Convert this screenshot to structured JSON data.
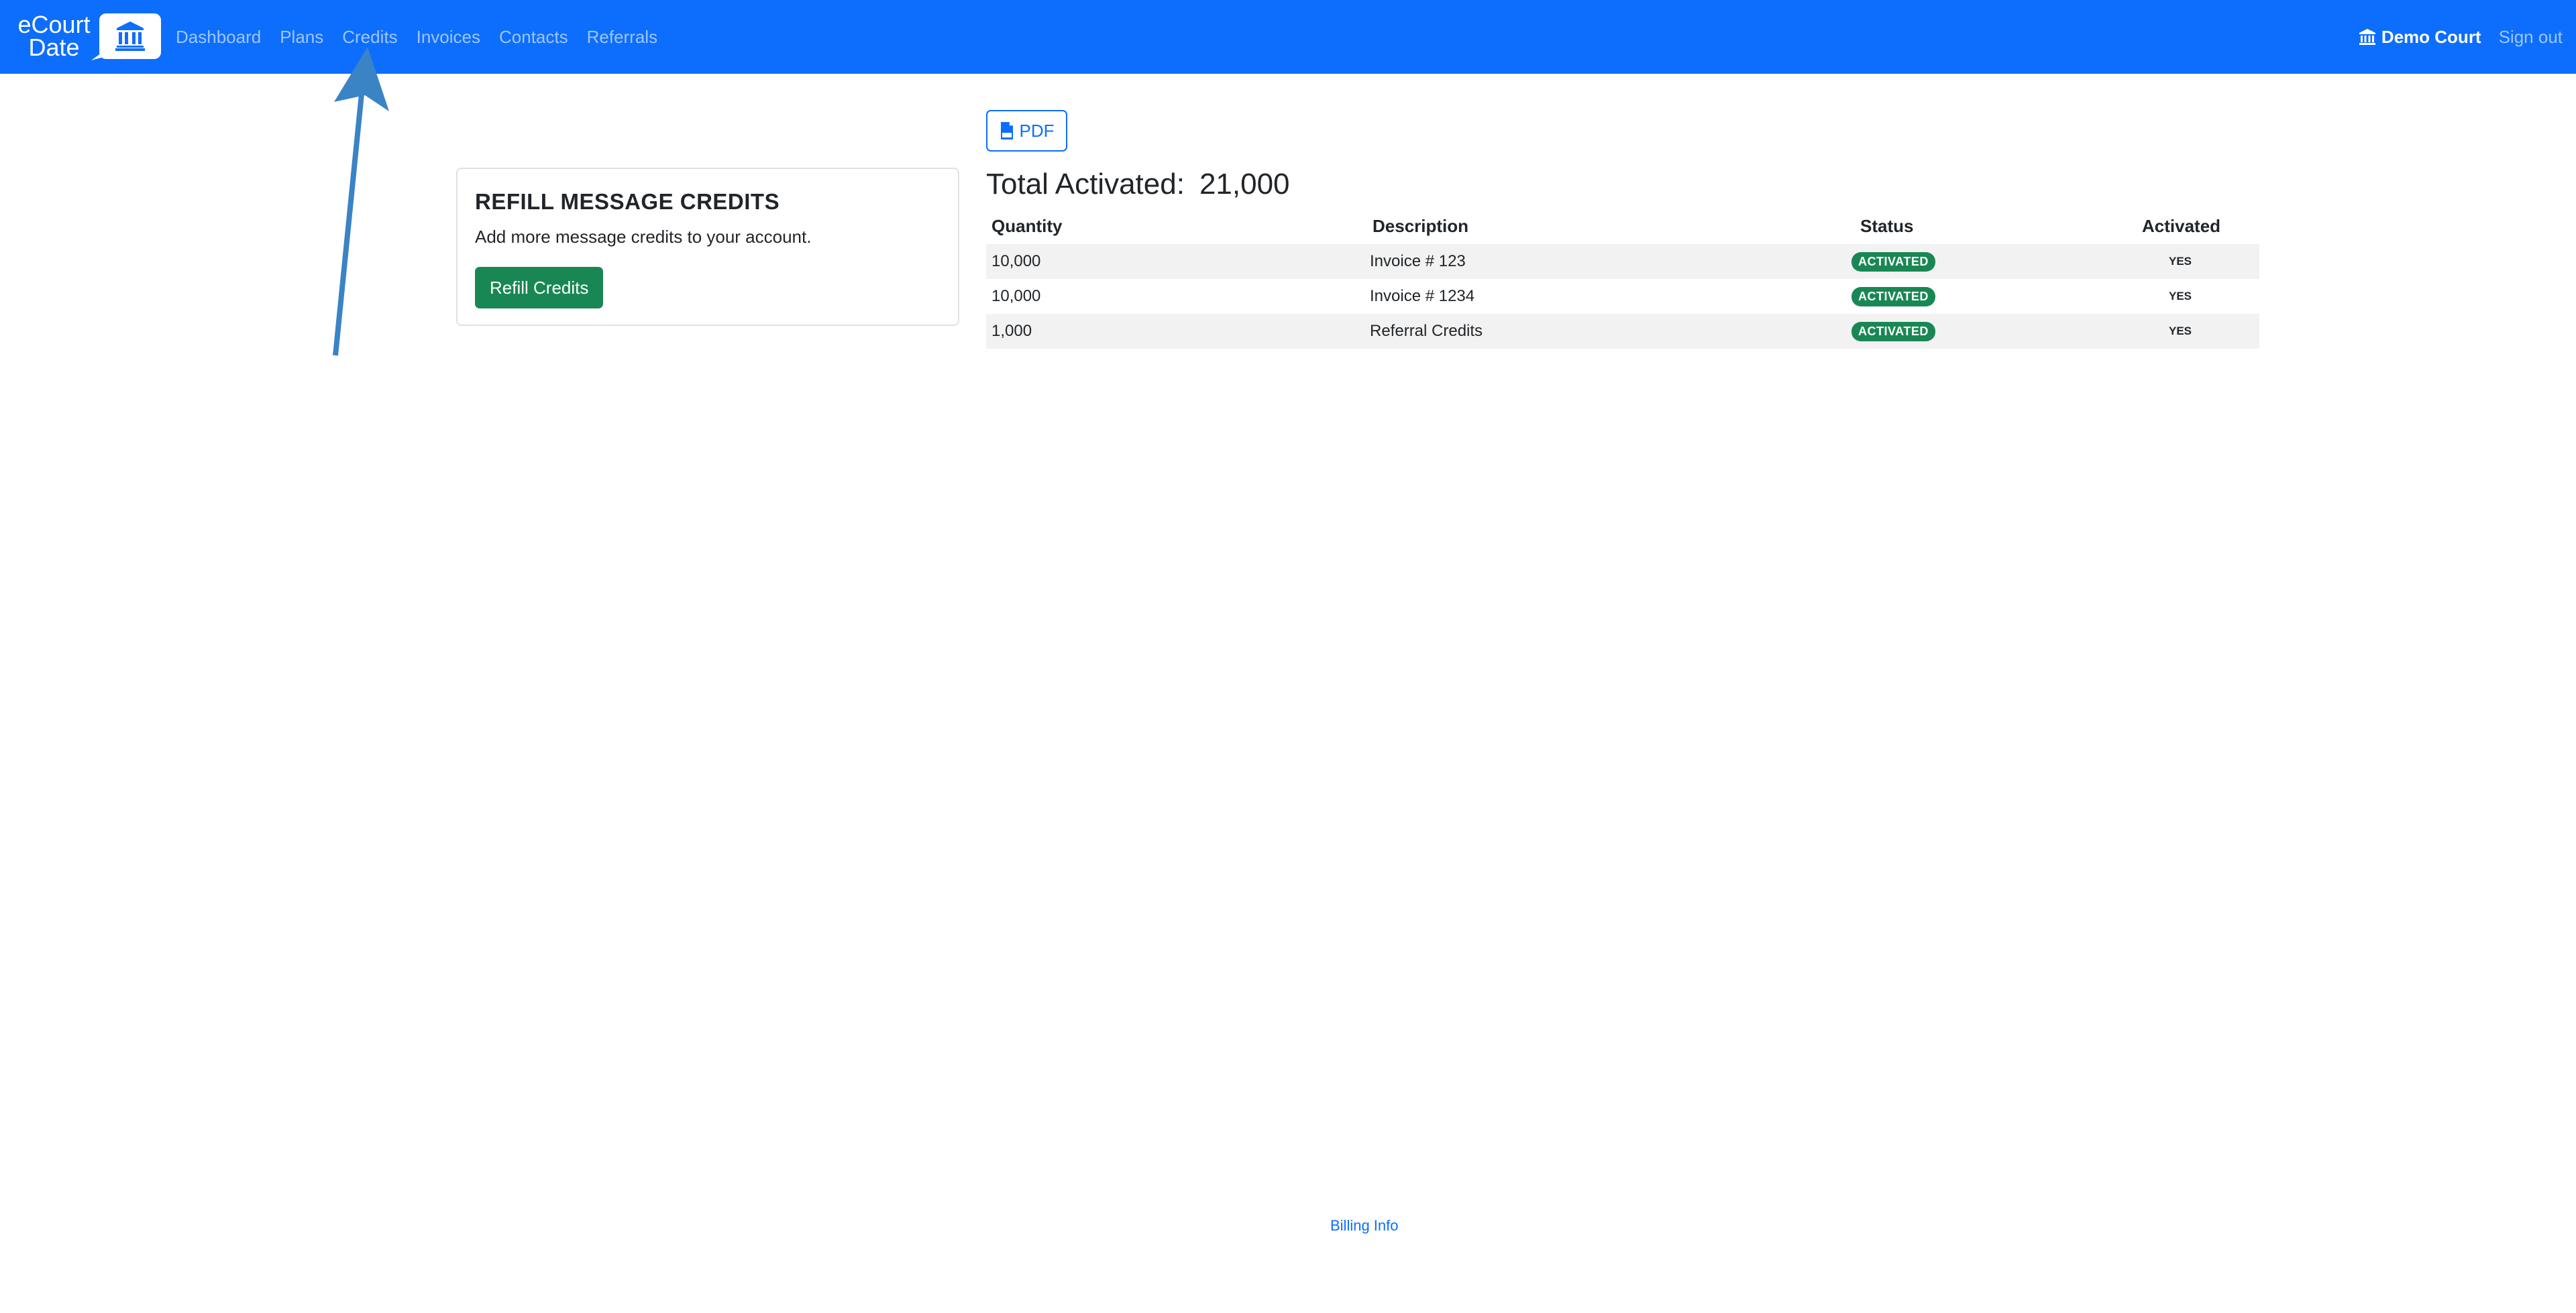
{
  "navbar": {
    "brand_line1": "eCourt",
    "brand_line2": "Date",
    "links": [
      {
        "label": "Dashboard"
      },
      {
        "label": "Plans"
      },
      {
        "label": "Credits"
      },
      {
        "label": "Invoices"
      },
      {
        "label": "Contacts"
      },
      {
        "label": "Referrals"
      }
    ],
    "court_name": "Demo Court",
    "signout_label": "Sign out",
    "colors": {
      "background": "#0d6efd"
    }
  },
  "refill_card": {
    "title": "REFILL MESSAGE CREDITS",
    "text": "Add more message credits to your account.",
    "button_label": "Refill Credits"
  },
  "pdf_button_label": "PDF",
  "summary": {
    "label": "Total Activated:",
    "value": "21,000"
  },
  "table": {
    "headers": {
      "quantity": "Quantity",
      "description": "Description",
      "status": "Status",
      "activated": "Activated"
    },
    "rows": [
      {
        "quantity": "10,000",
        "description": "Invoice # 123",
        "status": "ACTIVATED",
        "activated": "YES"
      },
      {
        "quantity": "10,000",
        "description": "Invoice # 1234",
        "status": "ACTIVATED",
        "activated": "YES"
      },
      {
        "quantity": "1,000",
        "description": "Referral Credits",
        "status": "ACTIVATED",
        "activated": "YES"
      }
    ]
  },
  "footer": {
    "billing_link": "Billing Info"
  },
  "icons": {
    "brand": "courthouse-icon",
    "court": "bank-icon",
    "pdf": "file-pdf-icon",
    "annotation": "arrow-up-icon"
  }
}
